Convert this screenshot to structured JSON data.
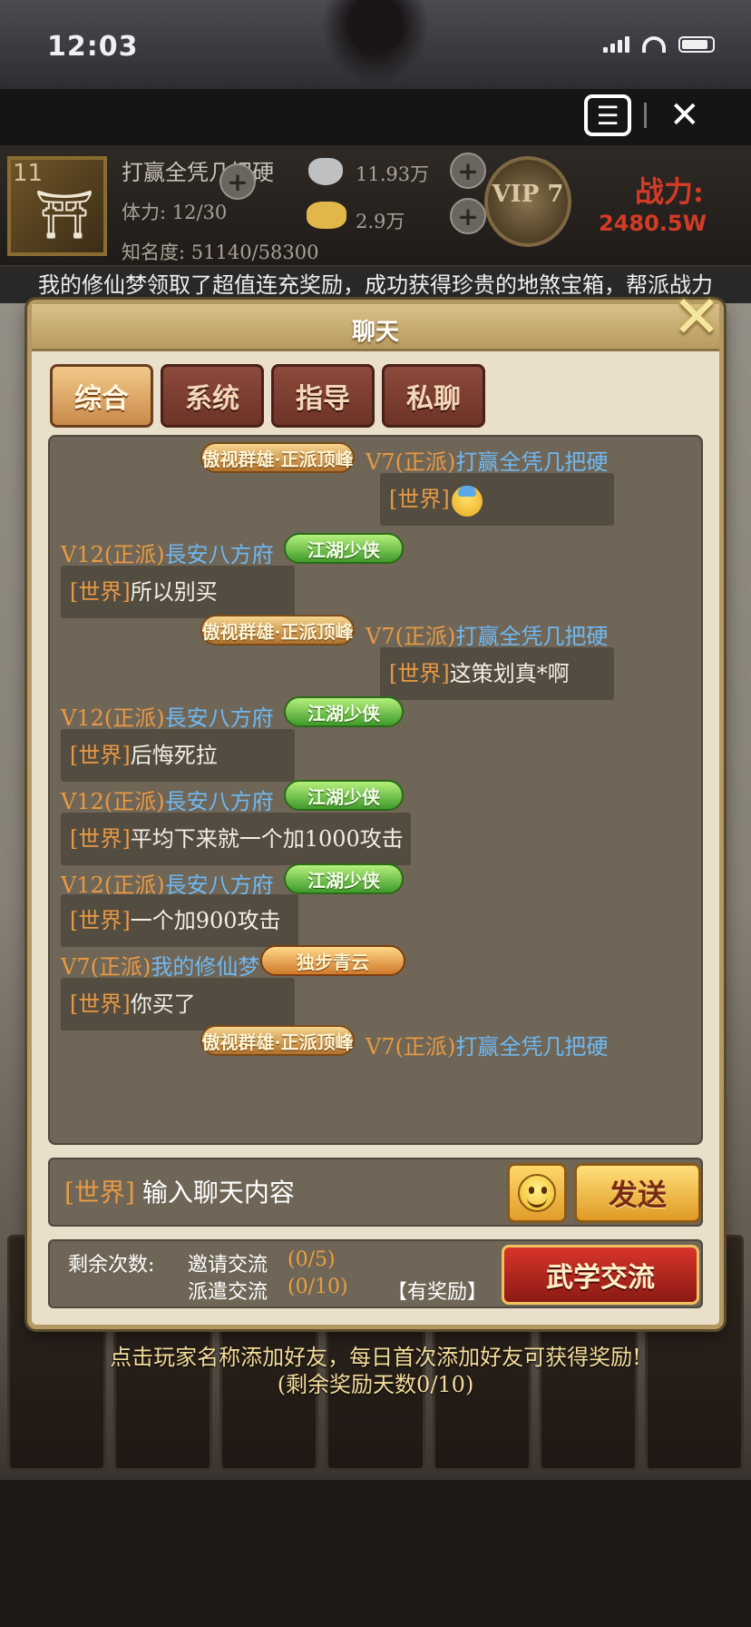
{
  "status_bar": {
    "time": "12:03"
  },
  "top_bar": {
    "menu_icon": "menu-icon",
    "close_icon": "close-icon"
  },
  "player": {
    "level": "11",
    "name": "打赢全凭几把硬",
    "stamina": "体力: 12/30",
    "fame": "知名度: 51140/58300",
    "silver": "11.93万",
    "gold": "2.9万",
    "vip": "VIP 7",
    "power_label": "战力:",
    "power_value": "2480.5W"
  },
  "ticker": "我的修仙梦领取了超值连充奖励，成功获得珍贵的地煞宝箱，帮派战力",
  "chat": {
    "title": "聊天",
    "tabs": [
      {
        "label": "综合",
        "active": true
      },
      {
        "label": "系统",
        "active": false
      },
      {
        "label": "指导",
        "active": false
      },
      {
        "label": "私聊",
        "active": false
      }
    ],
    "messages": [
      {
        "side": "right",
        "vip": "V7(正派)",
        "name": "打赢全凭几把硬",
        "badge": "傲视群雄·正派顶峰",
        "channel": "[世界]",
        "text": "",
        "emoji": "anxious-face-emoji"
      },
      {
        "side": "left",
        "vip": "V12(正派)",
        "name": "長安八方府",
        "badge": "江湖少侠",
        "channel": "[世界]",
        "text": "所以别买"
      },
      {
        "side": "right",
        "vip": "V7(正派)",
        "name": "打赢全凭几把硬",
        "badge": "傲视群雄·正派顶峰",
        "channel": "[世界]",
        "text": "这策划真*啊"
      },
      {
        "side": "left",
        "vip": "V12(正派)",
        "name": "長安八方府",
        "badge": "江湖少侠",
        "channel": "[世界]",
        "text": "后悔死拉"
      },
      {
        "side": "left",
        "vip": "V12(正派)",
        "name": "長安八方府",
        "badge": "江湖少侠",
        "channel": "[世界]",
        "text": "平均下来就一个加1000攻击"
      },
      {
        "side": "left",
        "vip": "V12(正派)",
        "name": "長安八方府",
        "badge": "江湖少侠",
        "channel": "[世界]",
        "text": "一个加900攻击"
      },
      {
        "side": "left",
        "vip": "V7(正派)",
        "name": "我的修仙梦",
        "badge": "独步青云",
        "channel": "[世界]",
        "text": "你买了"
      },
      {
        "side": "right",
        "vip": "V7(正派)",
        "name": "打赢全凭几把硬",
        "badge": "傲视群雄·正派顶峰"
      }
    ],
    "input": {
      "channel": "[世界]",
      "placeholder": "输入聊天内容"
    },
    "send_label": "发送",
    "remaining_label": "剩余次数:",
    "invite_label": "邀请交流",
    "invite_count": "(0/5)",
    "dispatch_label": "派遣交流",
    "dispatch_count": "(0/10)",
    "reward_tag": "【有奖励】",
    "martial_button": "武学交流"
  },
  "hint": {
    "line1": "点击玩家名称添加好友，每日首次添加好友可获得奖励!",
    "line2": "(剩余奖励天数0/10)"
  },
  "colors": {
    "vip": "#e89a43",
    "name": "#6fb8f2",
    "channel": "#e89a43",
    "tab_active": "#f2c98a",
    "tab_inactive": "#8c4a3c"
  }
}
